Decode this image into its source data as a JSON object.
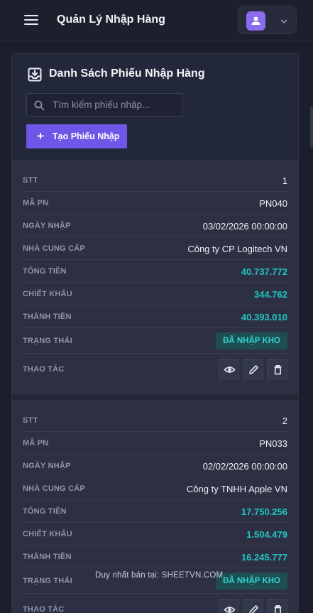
{
  "header": {
    "title": "Quản Lý Nhập Hàng",
    "menu_icon": "menu-icon",
    "user_icon": "user-icon",
    "dropdown_icon": "chevron-down-icon"
  },
  "panel": {
    "title": "Danh Sách Phiếu Nhập Hàng",
    "title_icon": "import-box-icon",
    "search": {
      "placeholder": "Tìm kiếm phiếu nhập...",
      "value": ""
    },
    "create_label": "Tạo Phiếu Nhập"
  },
  "labels": {
    "stt": "STT",
    "ma_pn": "MÃ PN",
    "ngay_nhap": "NGÀY NHẬP",
    "ncc": "NHÀ CUNG CẤP",
    "tong_tien": "TỔNG TIỀN",
    "chiet_khau": "CHIẾT KHẤU",
    "thanh_tien": "THÀNH TIỀN",
    "trang_thai": "TRẠNG THÁI",
    "thao_tac": "THAO TÁC"
  },
  "records": [
    {
      "stt": "1",
      "ma_pn": "PN040",
      "ngay_nhap": "03/02/2026 00:00:00",
      "ncc": "Công ty CP Logitech VN",
      "tong_tien": "40.737.772",
      "chiet_khau": "344.762",
      "thanh_tien": "40.393.010",
      "trang_thai": "ĐÃ NHẬP KHO"
    },
    {
      "stt": "2",
      "ma_pn": "PN033",
      "ngay_nhap": "02/02/2026 00:00:00",
      "ncc": "Công ty TNHH Apple VN",
      "tong_tien": "17.750.256",
      "chiet_khau": "1.504.479",
      "thanh_tien": "16.245.777",
      "trang_thai": "ĐÃ NHẬP KHO"
    }
  ],
  "watermark": "Duy nhất bán tại: SHEETVN.COM",
  "colors": {
    "accent": "#6d56e8",
    "money": "#22c4c0",
    "badge_bg": "#1f4d54",
    "badge_text": "#2ed3cb"
  }
}
